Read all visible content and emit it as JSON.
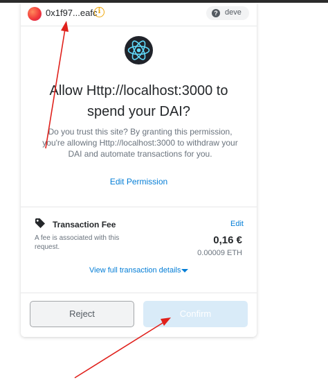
{
  "header": {
    "account_name": "0x1f97...eafc",
    "network_label": "deve",
    "info_icon": "info-circle-icon",
    "help_icon": "question-circle-icon"
  },
  "main": {
    "site_icon": "react-logo-icon",
    "title_line1": "Allow Http://localhost:3000 to",
    "title_line2": "spend your DAI?",
    "description": "Do you trust this site? By granting this permission, you're allowing Http://localhost:3000 to withdraw your DAI and automate transactions for you.",
    "edit_permission": "Edit Permission"
  },
  "fee": {
    "icon": "tag-icon",
    "title": "Transaction Fee",
    "edit_label": "Edit",
    "note": "A fee is associated with this request.",
    "fiat_amount": "0,16 €",
    "eth_amount": "0.00009 ETH",
    "view_details": "View full transaction details"
  },
  "actions": {
    "reject_label": "Reject",
    "confirm_label": "Confirm"
  },
  "colors": {
    "accent": "#037dd6",
    "annotation_arrow": "#e0201b",
    "confirm_disabled": "#d9ebf8",
    "warning": "#f0a70a"
  }
}
